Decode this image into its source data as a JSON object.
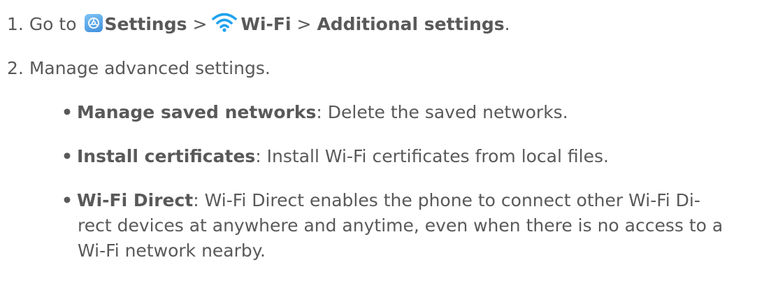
{
  "step1": {
    "number": "1.",
    "go_to": "Go to",
    "settings_label": "Settings",
    "sep1": ">",
    "wifi_label": "Wi-Fi",
    "sep2": ">",
    "additional_label": "Additional settings",
    "period": "."
  },
  "step2": {
    "number": "2.",
    "text": "Manage advanced settings."
  },
  "bullets": [
    {
      "marker": "•",
      "term": "Manage saved networks",
      "description": ": Delete the saved networks."
    },
    {
      "marker": "•",
      "term": "Install certificates",
      "description": ": Install Wi-Fi certificates from local files."
    },
    {
      "marker": "•",
      "term": "Wi-Fi Direct",
      "description": ": Wi-Fi Direct enables the phone to connect other Wi-Fi Di-",
      "continuation_1": "rect devices at anywhere and anytime, even when there is no access to a",
      "continuation_2": "Wi-Fi network nearby."
    }
  ],
  "icons": {
    "settings": "settings-gear-icon",
    "wifi": "wifi-icon"
  },
  "colors": {
    "text": "#595959",
    "settings_icon": "#4a9ae0",
    "wifi_icon": "#1fa2ee"
  }
}
